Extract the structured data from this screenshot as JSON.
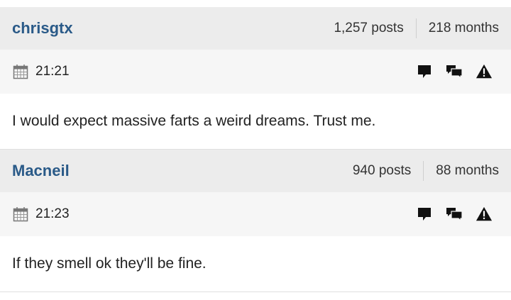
{
  "posts": [
    {
      "username": "chrisgtx",
      "post_count": "1,257 posts",
      "membership": "218 months",
      "time": "21:21",
      "body": "I would expect massive farts a weird dreams. Trust me."
    },
    {
      "username": "Macneil",
      "post_count": "940 posts",
      "membership": "88 months",
      "time": "21:23",
      "body": "If they smell ok they'll be fine."
    }
  ],
  "icons": {
    "date": "calendar-icon",
    "reply": "reply-speech-bubble-icon",
    "quote": "quote-speech-bubbles-icon",
    "report": "warning-triangle-icon"
  },
  "colors": {
    "username": "#2a5a88",
    "header_bg": "#ececec",
    "meta_bg": "#f6f6f6"
  }
}
